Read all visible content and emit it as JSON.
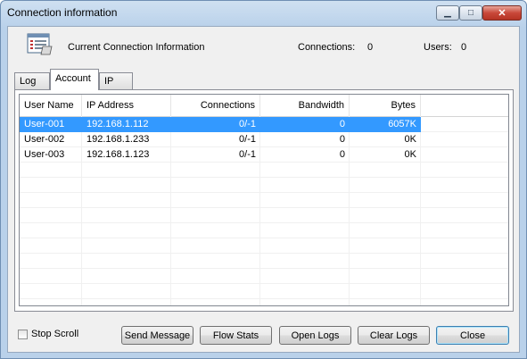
{
  "window": {
    "title": "Connection information",
    "minimize_symbol": "▁",
    "maximize_symbol": "□",
    "close_symbol": "✕"
  },
  "header": {
    "label": "Current Connection Information",
    "connections_label": "Connections:",
    "connections_value": "0",
    "users_label": "Users:",
    "users_value": "0",
    "icon": "connection-list-icon"
  },
  "tabs": [
    {
      "label": "Log",
      "active": false
    },
    {
      "label": "Account",
      "active": true
    },
    {
      "label": "IP",
      "active": false
    }
  ],
  "table": {
    "columns": [
      "User Name",
      "IP Address",
      "Connections",
      "Bandwidth",
      "Bytes"
    ],
    "rows": [
      {
        "user": "User-001",
        "ip": "192.168.1.112",
        "connections": "0/-1",
        "bandwidth": "0",
        "bytes": "6057K",
        "selected": true
      },
      {
        "user": "User-002",
        "ip": "192.168.1.233",
        "connections": "0/-1",
        "bandwidth": "0",
        "bytes": "0K",
        "selected": false
      },
      {
        "user": "User-003",
        "ip": "192.168.1.123",
        "connections": "0/-1",
        "bandwidth": "0",
        "bytes": "0K",
        "selected": false
      }
    ]
  },
  "footer": {
    "stop_scroll_label": "Stop Scroll",
    "stop_scroll_checked": false,
    "send_message": "Send Message",
    "flow_stats": "Flow Stats",
    "open_logs": "Open Logs",
    "clear_logs": "Clear Logs",
    "close": "Close"
  },
  "colors": {
    "selection": "#3399ff",
    "title_gradient": "#b9d1ea",
    "close_button": "#c9483a"
  }
}
